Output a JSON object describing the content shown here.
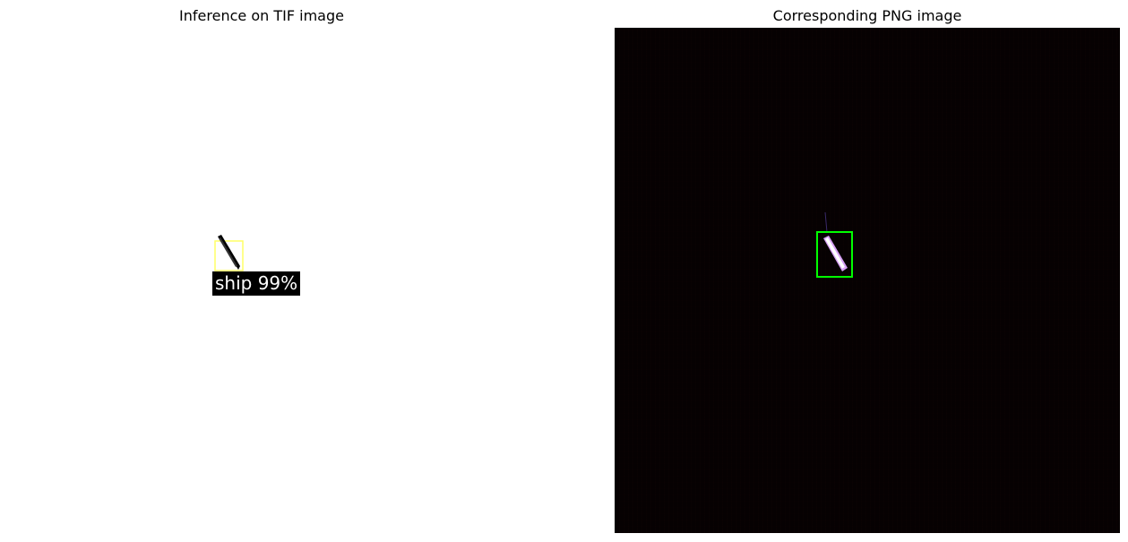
{
  "panels": {
    "left": {
      "title": "Inference on TIF image"
    },
    "right": {
      "title": "Corresponding PNG image"
    }
  },
  "detection": {
    "label": "ship 99%",
    "box_color_left": "#ffff66",
    "box_color_right": "#00ff00"
  },
  "colors": {
    "left_background": "#ffffff",
    "right_background": "#060102",
    "ship_left": "#000000",
    "ship_right": "#ffffff"
  }
}
